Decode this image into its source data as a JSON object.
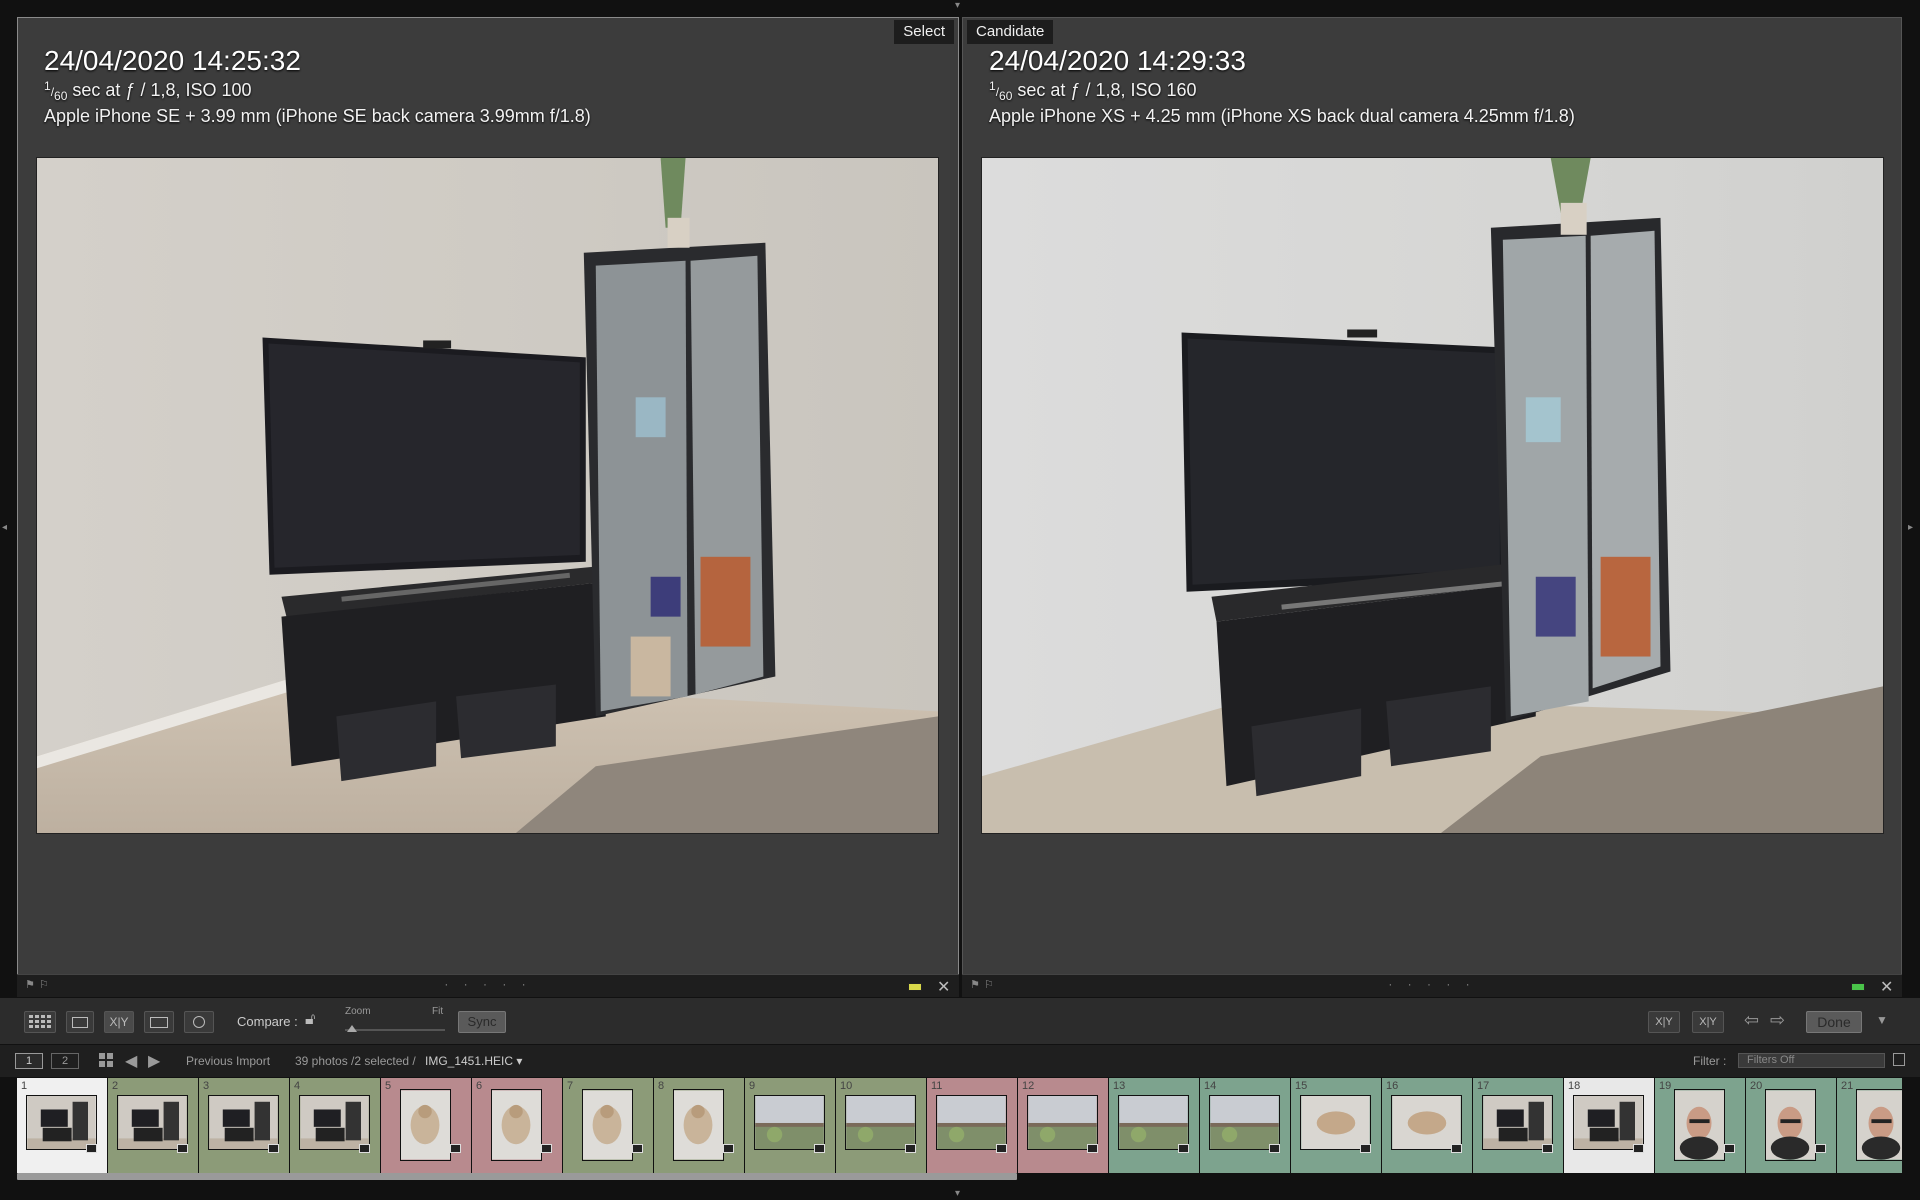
{
  "left_pane": {
    "tag": "Select",
    "date": "24/04/2020 14:25:32",
    "shutter_num": "1",
    "shutter_den": "60",
    "exposure": "sec at ƒ / 1,8, ISO 100",
    "camera": "Apple iPhone SE + 3.99 mm (iPhone SE back camera 3.99mm f/1.8)"
  },
  "right_pane": {
    "tag": "Candidate",
    "date": "24/04/2020 14:29:33",
    "shutter_num": "1",
    "shutter_den": "60",
    "exposure": "sec at ƒ / 1,8, ISO 160",
    "camera": "Apple iPhone XS + 4.25 mm (iPhone XS back dual camera 4.25mm f/1.8)"
  },
  "pane_bar": {
    "rating_dots": "· · · · ·",
    "left_color": "#d8d84a",
    "right_color": "#4ac44a"
  },
  "toolbar": {
    "compare_label": "Compare :",
    "zoom_label": "Zoom",
    "fit_label": "Fit",
    "sync_label": "Sync",
    "done_label": "Done",
    "xy_label": "X|Y"
  },
  "filmstrip_header": {
    "monitor1": "1",
    "monitor2": "2",
    "source": "Previous Import",
    "selection_info": "39 photos /2 selected /",
    "filename": "IMG_1451.HEIC ▾",
    "filter_label": "Filter :",
    "filter_value": "Filters Off"
  },
  "filmstrip": [
    {
      "num": "1",
      "bg": "#f0f0f0",
      "kind": "room"
    },
    {
      "num": "2",
      "bg": "#8c9b78",
      "kind": "room"
    },
    {
      "num": "3",
      "bg": "#8c9b78",
      "kind": "room"
    },
    {
      "num": "4",
      "bg": "#8c9b78",
      "kind": "room"
    },
    {
      "num": "5",
      "bg": "#b88a8e",
      "kind": "cat"
    },
    {
      "num": "6",
      "bg": "#b88a8e",
      "kind": "cat"
    },
    {
      "num": "7",
      "bg": "#8c9b78",
      "kind": "cat"
    },
    {
      "num": "8",
      "bg": "#8c9b78",
      "kind": "cat"
    },
    {
      "num": "9",
      "bg": "#8c9b78",
      "kind": "field"
    },
    {
      "num": "10",
      "bg": "#8c9b78",
      "kind": "field"
    },
    {
      "num": "11",
      "bg": "#b88a8e",
      "kind": "field"
    },
    {
      "num": "12",
      "bg": "#b88a8e",
      "kind": "field"
    },
    {
      "num": "13",
      "bg": "#7da38e",
      "kind": "field"
    },
    {
      "num": "14",
      "bg": "#7da38e",
      "kind": "field"
    },
    {
      "num": "15",
      "bg": "#7da38e",
      "kind": "cat2"
    },
    {
      "num": "16",
      "bg": "#7da38e",
      "kind": "cat2"
    },
    {
      "num": "17",
      "bg": "#7da38e",
      "kind": "room"
    },
    {
      "num": "18",
      "bg": "#e8e8e8",
      "kind": "room"
    },
    {
      "num": "19",
      "bg": "#7da38e",
      "kind": "face"
    },
    {
      "num": "20",
      "bg": "#7da38e",
      "kind": "face"
    },
    {
      "num": "21",
      "bg": "#7da38e",
      "kind": "face"
    }
  ]
}
